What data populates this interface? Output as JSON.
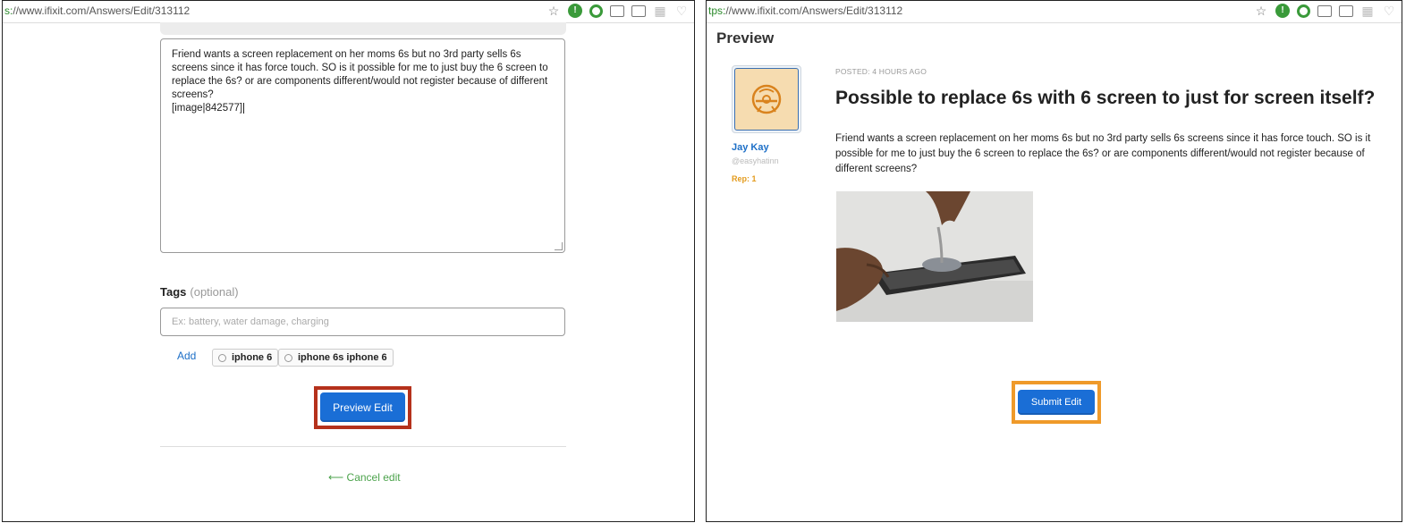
{
  "left": {
    "url": {
      "scheme_part": "s:",
      "host_path": "//www.ifixit.com/Answers/Edit/313112"
    },
    "editor": {
      "body": "Friend wants a screen replacement on her moms 6s but no 3rd party sells 6s screens since it has force touch. SO is it possible for me to just buy the 6 screen to replace the 6s? or are components different/would not register because of different screens?",
      "image_tag": "[image|842577]"
    },
    "tags": {
      "label": "Tags",
      "optional": "(optional)",
      "placeholder": "Ex: battery, water damage, charging",
      "add_label": "Add",
      "chips": [
        "iphone 6",
        "iphone 6s iphone 6"
      ]
    },
    "preview_button": "Preview Edit",
    "cancel_label": "Cancel edit"
  },
  "right": {
    "url": {
      "scheme_part": "tps:",
      "host_path": "//www.ifixit.com/Answers/Edit/313112"
    },
    "preview_heading": "Preview",
    "user": {
      "name": "Jay Kay",
      "handle": "@easyhatinn",
      "rep": "Rep: 1"
    },
    "posted": "POSTED: 4 HOURS AGO",
    "question_title": "Possible to replace 6s with 6 screen to just for screen itself?",
    "question_body": "Friend wants a screen replacement on her moms 6s but no 3rd party sells 6s screens since it has force touch. SO is it possible for me to just buy the 6 screen to replace the 6s? or are components different/would not register because of different screens?",
    "submit_button": "Submit Edit"
  },
  "colors": {
    "primary_button": "#1a6ed6",
    "highlight_red": "#b5311b",
    "highlight_orange": "#ef9a2a",
    "link_blue": "#1d6fc7",
    "cancel_green": "#4ca34c",
    "rep_orange": "#e39b1d"
  },
  "icons": [
    "star-icon",
    "extension-icon",
    "refresh-icon",
    "cast-icon",
    "window-icon",
    "qr-icon",
    "pocket-icon",
    "arrow-left-icon",
    "saw-blade-icon"
  ]
}
